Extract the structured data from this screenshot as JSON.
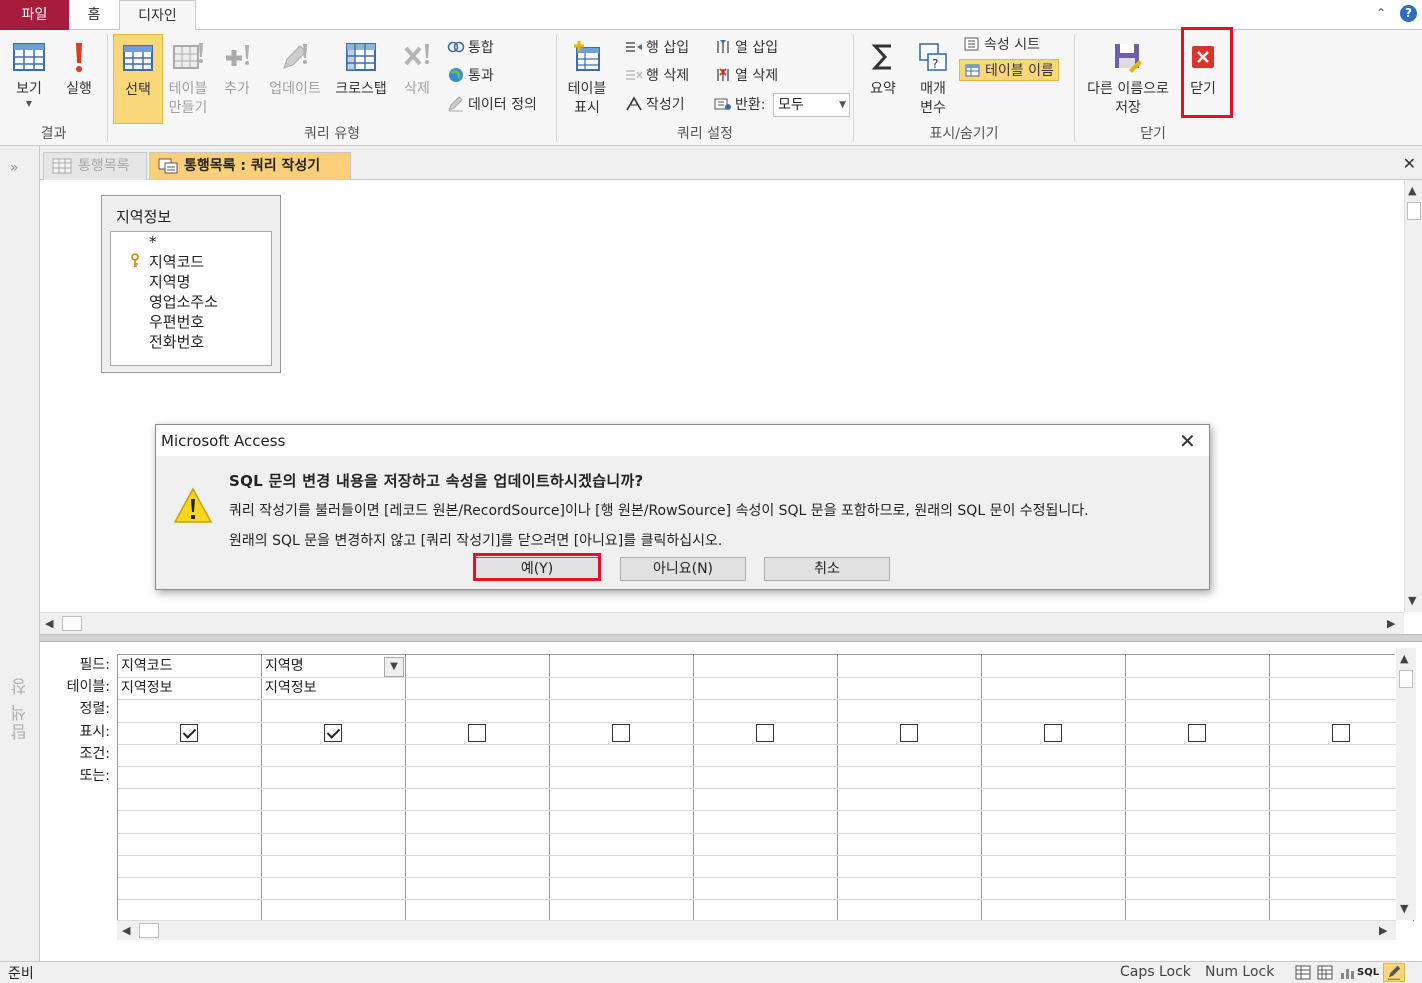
{
  "ribbon": {
    "tabs": {
      "file": "파일",
      "home": "홈",
      "design": "디자인"
    },
    "groups": {
      "results": {
        "label": "결과",
        "view": "보기",
        "run": "실행"
      },
      "query_type": {
        "label": "쿼리 유형",
        "select": "선택",
        "make_table_1": "테이블",
        "make_table_2": "만들기",
        "append": "추가",
        "update": "업데이트",
        "crosstab": "크로스탭",
        "delete": "삭제",
        "union": "통합",
        "pass_through": "통과",
        "data_definition": "데이터 정의"
      },
      "query_setup": {
        "label": "쿼리 설정",
        "show_table_1": "테이블",
        "show_table_2": "표시",
        "insert_rows": "행 삽입",
        "delete_rows": "행 삭제",
        "builder": "작성기",
        "insert_columns": "열 삽입",
        "delete_columns": "열 삭제",
        "return_label": "반환:",
        "return_value": "모두"
      },
      "show_hide": {
        "label": "표시/숨기기",
        "totals": "요약",
        "parameters_1": "매개",
        "parameters_2": "변수",
        "property_sheet": "속성 시트",
        "table_names": "테이블 이름"
      },
      "close": {
        "label": "닫기",
        "save_as_1": "다른 이름으로",
        "save_as_2": "저장",
        "close": "닫기"
      }
    }
  },
  "nav_pane": {
    "toggle": "»",
    "label": "탐색 창"
  },
  "doc_tabs": {
    "tab1": "통행목록",
    "tab2": "통행목록 : 쿼리 작성기"
  },
  "field_list": {
    "title": "지역정보",
    "items": [
      "*",
      "지역코드",
      "지역명",
      "영업소주소",
      "우편번호",
      "전화번호"
    ]
  },
  "grid": {
    "row_labels": [
      "필드:",
      "테이블:",
      "정렬:",
      "표시:",
      "조건:",
      "또는:"
    ],
    "col1": {
      "field": "지역코드",
      "table": "지역정보"
    },
    "col2": {
      "field": "지역명",
      "table": "지역정보"
    },
    "show_checked": [
      true,
      true,
      false,
      false,
      false,
      false,
      false,
      false,
      false
    ]
  },
  "dialog": {
    "title": "Microsoft Access",
    "heading": "SQL 문의 변경 내용을 저장하고 속성을 업데이트하시겠습니까?",
    "line1": "쿼리 작성기를 불러들이면 [레코드 원본/RecordSource]이나 [행 원본/RowSource] 속성이 SQL 문을 포함하므로, 원래의 SQL 문이 수정됩니다.",
    "line2": "원래의 SQL 문을 변경하지 않고 [쿼리 작성기]를 닫으려면 [아니요]를 클릭하십시오.",
    "yes": "예(Y)",
    "no": "아니요(N)",
    "cancel": "취소"
  },
  "status": {
    "text": "준비",
    "caps": "Caps Lock",
    "num": "Num Lock",
    "sql": "SQL"
  },
  "colors": {
    "file_tab": "#a61c3c",
    "highlight": "#e0141e",
    "active_tab": "#fbcf7a",
    "select_btn": "#fad87a"
  }
}
